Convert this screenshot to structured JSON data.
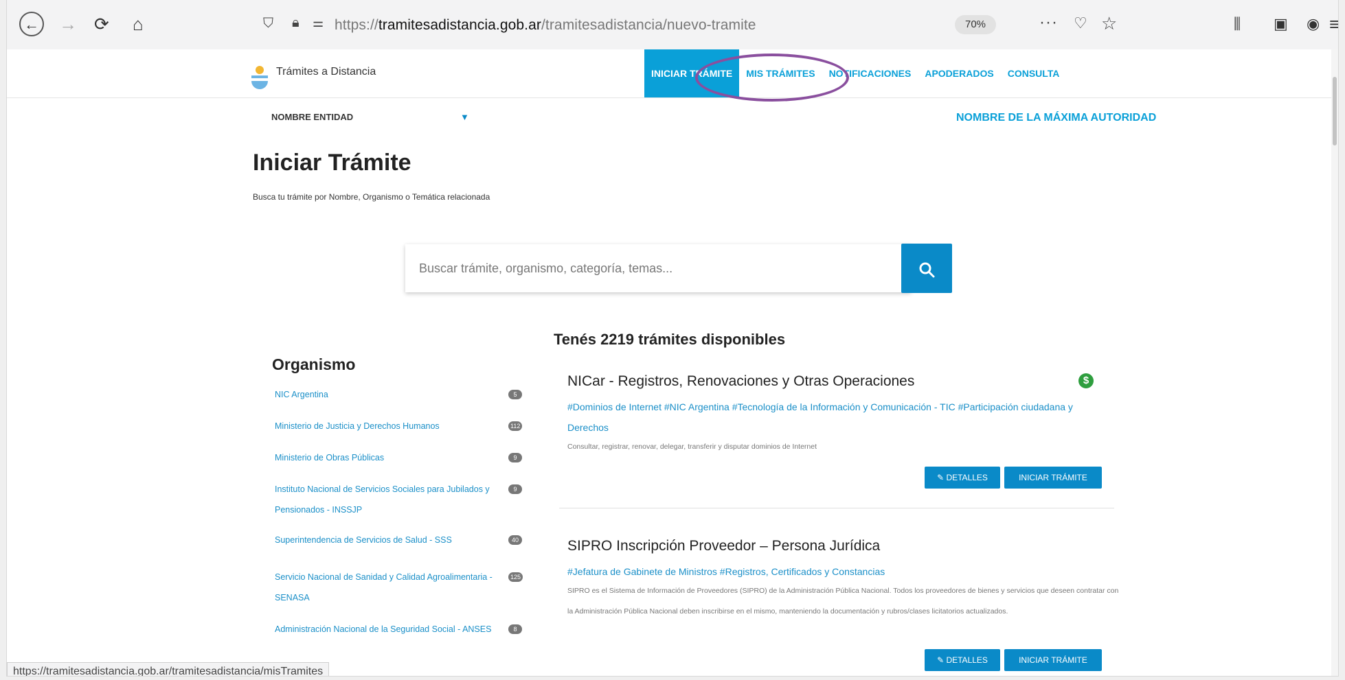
{
  "browser": {
    "url_prefix": "https://",
    "url_domain": "tramitesadistancia.gob.ar",
    "url_path": "/tramitesadistancia/nuevo-tramite",
    "zoom": "70%",
    "status_url": "https://tramitesadistancia.gob.ar/tramitesadistancia/misTramites"
  },
  "header": {
    "brand": "Trámites a Distancia",
    "nav": [
      "INICIAR TRÁMITE",
      "MIS TRÁMITES",
      "NOTIFICACIONES",
      "APODERADOS",
      "CONSULTA"
    ],
    "active_nav": "INICIAR TRÁMITE",
    "highlight_color": "#8a4f9e",
    "accent_color": "#0aa0d8"
  },
  "entity_bar": {
    "entity": "NOMBRE ENTIDAD",
    "authority": "NOMBRE DE LA MÁXIMA AUTORIDAD"
  },
  "main": {
    "title": "Iniciar Trámite",
    "subtitle": "Busca tu trámite por Nombre, Organismo o Temática relacionada",
    "search_placeholder": "Buscar trámite, organismo, categoría, temas...",
    "results_count": "Tenés 2219 trámites disponibles"
  },
  "sidebar": {
    "title": "Organismo",
    "items": [
      {
        "label": "NIC Argentina",
        "count": "5"
      },
      {
        "label": "Ministerio de Justicia y Derechos Humanos",
        "count": "112"
      },
      {
        "label": "Ministerio de Obras Públicas",
        "count": "9"
      },
      {
        "label": "Instituto Nacional de Servicios Sociales para Jubilados y Pensionados - INSSJP",
        "count": "9"
      },
      {
        "label": "Superintendencia de Servicios de Salud - SSS",
        "count": "40"
      },
      {
        "label": "Servicio Nacional de Sanidad y Calidad Agroalimentaria - SENASA",
        "count": "125"
      },
      {
        "label": "Administración Nacional de la Seguridad Social - ANSES",
        "count": "8"
      }
    ]
  },
  "cards": [
    {
      "title": "NICar - Registros, Renovaciones y Otras Operaciones",
      "tags": "#Dominios de Internet #NIC Argentina #Tecnología de la Información y Comunicación - TIC #Participación ciudadana y Derechos",
      "description": "Consultar, registrar, renovar, delegar, transferir y disputar dominios de Internet",
      "details_label": "✎ DETALLES",
      "start_label": "INICIAR TRÁMITE",
      "badge": "$"
    },
    {
      "title": "SIPRO Inscripción Proveedor – Persona Jurídica",
      "tags": "#Jefatura de Gabinete de Ministros #Registros, Certificados y Constancias",
      "description": "SIPRO es el Sistema de Información de Proveedores (SIPRO) de la Administración Pública Nacional. Todos los proveedores de bienes y servicios que deseen contratar con la Administración Pública Nacional deben inscribirse en el mismo, manteniendo la documentación y rubros/clases licitatorios actualizados.",
      "details_label": "✎ DETALLES",
      "start_label": "INICIAR TRÁMITE"
    }
  ]
}
